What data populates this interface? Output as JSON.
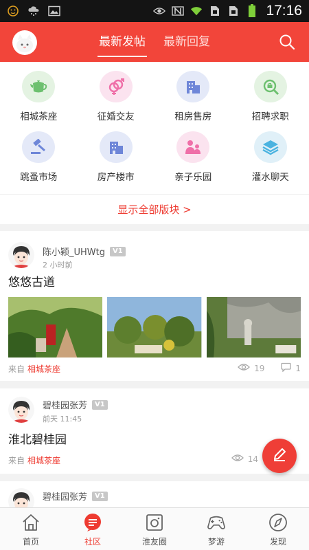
{
  "status_bar": {
    "time": "17:16"
  },
  "header": {
    "tabs": [
      {
        "label": "最新发帖",
        "active": true
      },
      {
        "label": "最新回复",
        "active": false
      }
    ]
  },
  "categories": [
    {
      "label": "相城茶座",
      "icon": "teapot-icon",
      "bg": "#e4f3e2",
      "color": "#6dc06f"
    },
    {
      "label": "征婚交友",
      "icon": "gender-icon",
      "bg": "#fbe3ef",
      "color": "#ef6fa8"
    },
    {
      "label": "租房售房",
      "icon": "building-icon",
      "bg": "#e4e9f8",
      "color": "#6e86d8"
    },
    {
      "label": "招聘求职",
      "icon": "job-search-icon",
      "bg": "#e4f3e2",
      "color": "#6dc06f"
    },
    {
      "label": "跳蚤市场",
      "icon": "auction-hammer-icon",
      "bg": "#e4e9f8",
      "color": "#6e86d8"
    },
    {
      "label": "房产楼市",
      "icon": "building-icon",
      "bg": "#e4e9f8",
      "color": "#6e86d8"
    },
    {
      "label": "亲子乐园",
      "icon": "parent-child-icon",
      "bg": "#fbe3ef",
      "color": "#ef6fa8"
    },
    {
      "label": "灌水聊天",
      "icon": "layers-icon",
      "bg": "#e0f0f8",
      "color": "#4ab3e0"
    }
  ],
  "show_all_label": "显示全部版块 >",
  "posts": [
    {
      "author": "陈小颖_UHWtg",
      "badge": "V1",
      "time": "2 小时前",
      "title": "悠悠古道",
      "from_prefix": "来自",
      "forum": "相城茶座",
      "views": "19",
      "comments": "1"
    },
    {
      "author": "碧桂园张芳",
      "badge": "V1",
      "time": "前天 11:45",
      "title": "淮北碧桂园",
      "from_prefix": "来自",
      "forum": "相城茶座",
      "views": "14"
    },
    {
      "author": "碧桂园张芳",
      "badge": "V1"
    }
  ],
  "bottom_nav": [
    {
      "label": "首页",
      "icon": "home-icon",
      "active": false
    },
    {
      "label": "社区",
      "icon": "community-chat-icon",
      "active": true
    },
    {
      "label": "淮友圈",
      "icon": "camera-frame-icon",
      "active": false
    },
    {
      "label": "梦游",
      "icon": "gamepad-icon",
      "active": false
    },
    {
      "label": "发现",
      "icon": "compass-icon",
      "active": false
    }
  ],
  "colors": {
    "accent": "#f2453a",
    "link": "#ee3b31"
  }
}
